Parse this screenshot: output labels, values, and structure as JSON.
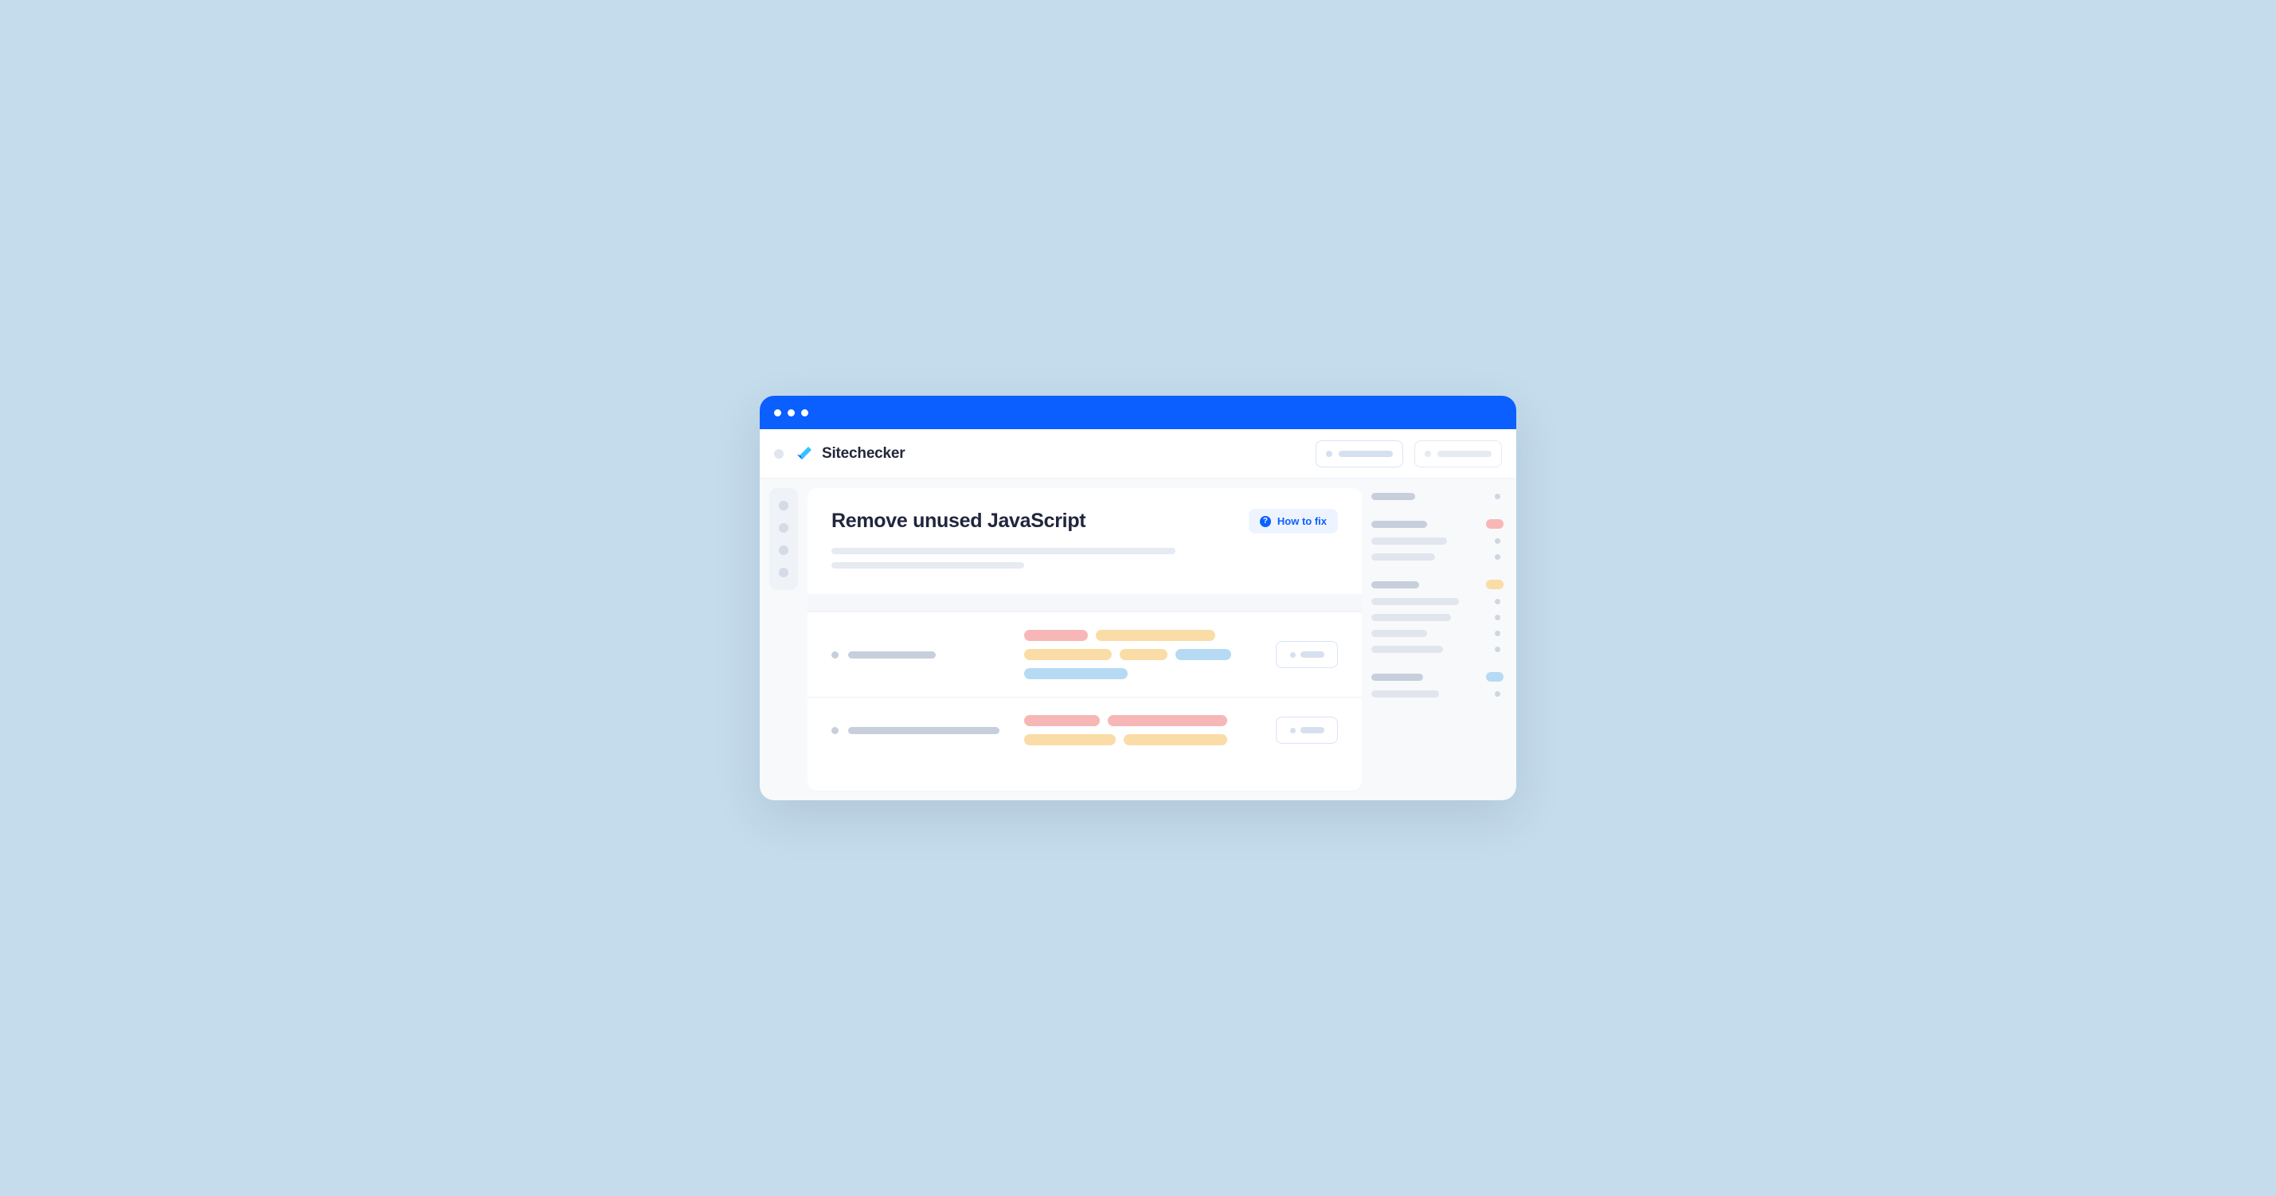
{
  "brand": "Sitechecker",
  "page_title": "Remove unused JavaScript",
  "how_to_fix_label": "How to fix",
  "colors": {
    "accent": "#0b5fff",
    "pink": "#f8b7b7",
    "orange": "#fadca6",
    "blue": "#b6daf3"
  }
}
